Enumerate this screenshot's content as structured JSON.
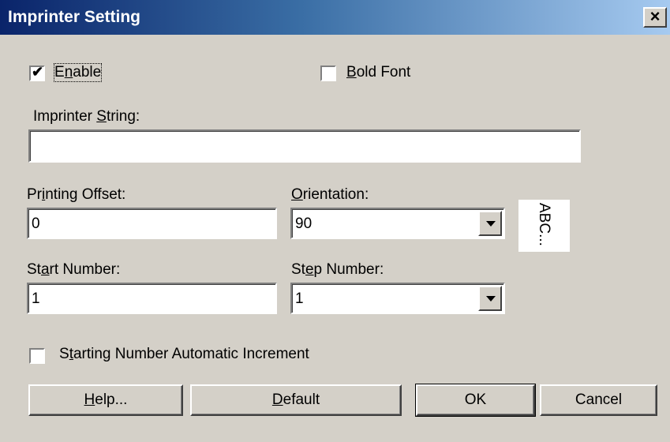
{
  "window": {
    "title": "Imprinter Setting",
    "close_glyph": "×"
  },
  "enable": {
    "label_pre": "E",
    "label_mnemonic": "n",
    "label_post": "able",
    "checked": true
  },
  "bold_font": {
    "label_mnemonic": "B",
    "label_post": "old Font",
    "checked": false
  },
  "imprinter_string": {
    "label_pre": "Imprinter ",
    "label_mnemonic": "S",
    "label_post": "tring:",
    "value": ""
  },
  "printing_offset": {
    "label_pre": "Pr",
    "label_mnemonic": "i",
    "label_post": "nting Offset:",
    "value": "0"
  },
  "orientation": {
    "label_mnemonic": "O",
    "label_post": "rientation:",
    "value": "90",
    "preview": "ABC..."
  },
  "start_number": {
    "label_pre": "St",
    "label_mnemonic": "a",
    "label_post": "rt Number:",
    "value": "1"
  },
  "step_number": {
    "label_pre": "St",
    "label_mnemonic": "e",
    "label_post": "p Number:",
    "value": "1"
  },
  "auto_increment": {
    "label_pre": "S",
    "label_mnemonic": "t",
    "label_post": "arting Number Automatic Increment",
    "checked": false
  },
  "buttons": {
    "help": {
      "mnemonic": "H",
      "post": "elp..."
    },
    "default": {
      "mnemonic": "D",
      "post": "efault"
    },
    "ok": "OK",
    "cancel": "Cancel"
  }
}
